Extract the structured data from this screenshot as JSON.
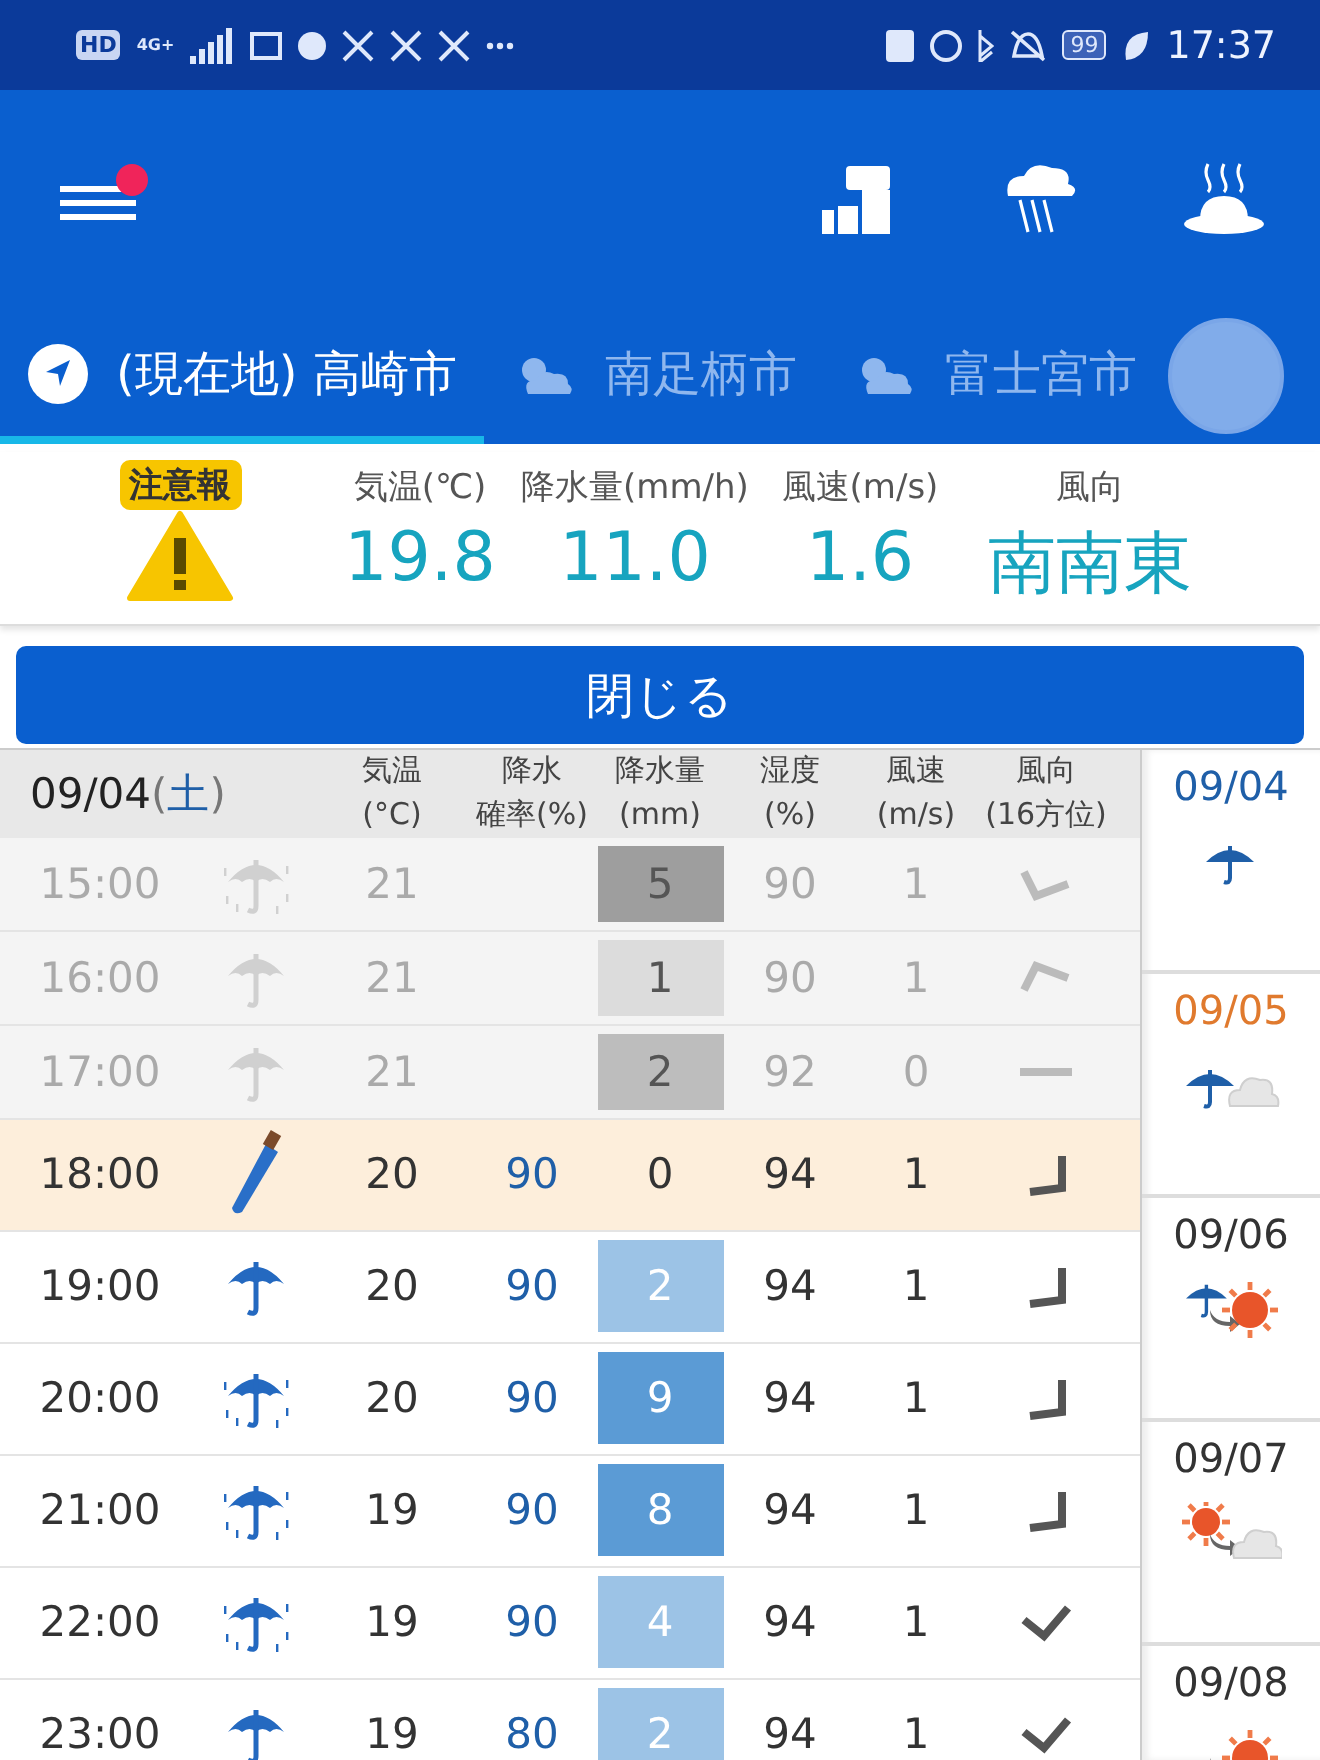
{
  "status_bar": {
    "hd": "HD",
    "network": "4G+",
    "battery": "99",
    "time": "17:37"
  },
  "app_bar": {
    "menu_badge": true
  },
  "tabs": [
    {
      "label": "(現在地) 高崎市",
      "kind": "location",
      "selected": true
    },
    {
      "label": "南足柄市",
      "kind": "weather",
      "selected": false
    },
    {
      "label": "富士宮市",
      "kind": "weather",
      "selected": false
    }
  ],
  "summary": {
    "alert": "注意報",
    "metrics": [
      {
        "label": "気温(℃)",
        "value": "19.8"
      },
      {
        "label": "降水量(mm/h)",
        "value": "11.0"
      },
      {
        "label": "風速(m/s)",
        "value": "1.6"
      },
      {
        "label": "風向",
        "value": "南南東"
      }
    ]
  },
  "close_button": "閉じる",
  "table": {
    "date": "09/04",
    "weekday_open": "(",
    "weekday": "土",
    "weekday_close": ")",
    "columns": [
      {
        "line1": "気温",
        "line2": "(°C)"
      },
      {
        "line1": "降水",
        "line2": "確率(%)"
      },
      {
        "line1": "降水量",
        "line2": "(mm)"
      },
      {
        "line1": "湿度",
        "line2": "(%)"
      },
      {
        "line1": "風速",
        "line2": "(m/s)"
      },
      {
        "line1": "風向",
        "line2": "(16方位)"
      }
    ],
    "rows": [
      {
        "time": "15:00",
        "kind": "rain",
        "past": true,
        "current": false,
        "temp": "21",
        "rain": "5",
        "color": "#9e9e9e",
        "humidity": "90",
        "wind": "1",
        "wind_direction": {
          "kind": "valley"
        }
      },
      {
        "time": "16:00",
        "kind": "umbrella",
        "past": true,
        "current": false,
        "temp": "21",
        "rain": "1",
        "color": "#dcdcdc",
        "humidity": "90",
        "wind": "1",
        "wind_direction": {
          "kind": "peak"
        }
      },
      {
        "time": "17:00",
        "kind": "umbrella",
        "past": true,
        "current": false,
        "temp": "21",
        "rain": "2",
        "color": "#bdbdbd",
        "humidity": "92",
        "wind": "0",
        "wind_direction": {
          "kind": "flat"
        }
      },
      {
        "time": "18:00",
        "kind": "closed",
        "past": false,
        "current": true,
        "temp": "20",
        "prob": "90",
        "rain": "0",
        "humidity": "94",
        "wind": "1",
        "wind_direction": {
          "kind": "corner"
        }
      },
      {
        "time": "19:00",
        "kind": "umbrella",
        "past": false,
        "current": false,
        "temp": "20",
        "prob": "90",
        "rain": "2",
        "color": "#9cc3e6",
        "humidity": "94",
        "wind": "1",
        "wind_direction": {
          "kind": "corner"
        }
      },
      {
        "time": "20:00",
        "kind": "rain",
        "past": false,
        "current": false,
        "temp": "20",
        "prob": "90",
        "rain": "9",
        "color": "#5b9bd5",
        "humidity": "94",
        "wind": "1",
        "wind_direction": {
          "kind": "corner"
        }
      },
      {
        "time": "21:00",
        "kind": "rain",
        "past": false,
        "current": false,
        "temp": "19",
        "prob": "90",
        "rain": "8",
        "color": "#5b9bd5",
        "humidity": "94",
        "wind": "1",
        "wind_direction": {
          "kind": "corner"
        }
      },
      {
        "time": "22:00",
        "kind": "rain",
        "past": false,
        "current": false,
        "temp": "19",
        "prob": "90",
        "rain": "4",
        "color": "#9cc3e6",
        "humidity": "94",
        "wind": "1",
        "wind_direction": {
          "kind": "check"
        }
      },
      {
        "time": "23:00",
        "kind": "umbrella",
        "past": false,
        "current": false,
        "temp": "19",
        "prob": "80",
        "rain": "2",
        "color": "#9cc3e6",
        "humidity": "94",
        "wind": "1",
        "wind_direction": {
          "kind": "check"
        }
      }
    ]
  },
  "days": [
    {
      "date": "09/04",
      "color": "#1f5fa8",
      "kind": "rain"
    },
    {
      "date": "09/05",
      "color": "#e07a2e",
      "kind": "rain_cloud"
    },
    {
      "date": "09/06",
      "color": "#333333",
      "kind": "rain_to_sun"
    },
    {
      "date": "09/07",
      "color": "#333333",
      "kind": "sun_to_cloud"
    },
    {
      "date": "09/08",
      "color": "#333333",
      "kind": "to_sun"
    }
  ]
}
